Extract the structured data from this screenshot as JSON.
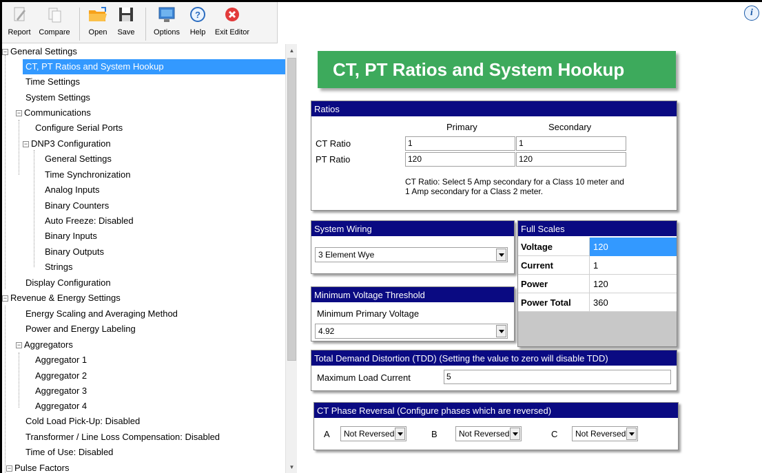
{
  "toolbar": {
    "buttons": [
      {
        "label": "Report",
        "icon": "report-icon"
      },
      {
        "label": "Compare",
        "icon": "compare-icon"
      },
      {
        "label": "Open",
        "icon": "folder-open-icon"
      },
      {
        "label": "Save",
        "icon": "floppy-disk-icon"
      },
      {
        "label": "Options",
        "icon": "options-monitor-icon"
      },
      {
        "label": "Help",
        "icon": "help-icon"
      },
      {
        "label": "Exit Editor",
        "icon": "exit-icon"
      }
    ],
    "info_glyph": "i"
  },
  "tree": {
    "items": [
      {
        "label": "General Settings",
        "expander": "−"
      },
      {
        "label": "CT, PT Ratios and System Hookup",
        "selected": true
      },
      {
        "label": "Time Settings"
      },
      {
        "label": "System Settings"
      },
      {
        "label": "Communications",
        "expander": "−"
      },
      {
        "label": "Configure Serial Ports"
      },
      {
        "label": "DNP3 Configuration",
        "expander": "−"
      },
      {
        "label": "General Settings"
      },
      {
        "label": "Time Synchronization"
      },
      {
        "label": "Analog Inputs"
      },
      {
        "label": "Binary Counters"
      },
      {
        "label": "Auto Freeze: Disabled"
      },
      {
        "label": "Binary Inputs"
      },
      {
        "label": "Binary Outputs"
      },
      {
        "label": "Strings"
      },
      {
        "label": "Display Configuration"
      },
      {
        "label": "Revenue & Energy Settings",
        "expander": "−"
      },
      {
        "label": "Energy Scaling and Averaging Method"
      },
      {
        "label": "Power and Energy Labeling"
      },
      {
        "label": "Aggregators",
        "expander": "−"
      },
      {
        "label": "Aggregator 1"
      },
      {
        "label": "Aggregator 2"
      },
      {
        "label": "Aggregator 3"
      },
      {
        "label": "Aggregator 4"
      },
      {
        "label": "Cold Load Pick-Up: Disabled"
      },
      {
        "label": "Transformer / Line Loss Compensation: Disabled"
      },
      {
        "label": "Time of Use: Disabled"
      },
      {
        "label": "Pulse Factors",
        "expander": "−"
      }
    ]
  },
  "page_title": "CT, PT Ratios and System Hookup",
  "ratios": {
    "header": "Ratios",
    "col_primary": "Primary",
    "col_secondary": "Secondary",
    "ct_label": "CT Ratio",
    "pt_label": "PT Ratio",
    "ct_primary": "1",
    "ct_secondary": "1",
    "pt_primary": "120",
    "pt_secondary": "120",
    "note_line1": "CT Ratio: Select 5 Amp secondary for a Class 10 meter and",
    "note_line2": "1 Amp secondary for a Class 2 meter."
  },
  "system_wiring": {
    "header": "System Wiring",
    "value": "3 Element Wye"
  },
  "full_scales": {
    "header": "Full Scales",
    "rows": [
      {
        "label": "Voltage",
        "value": "120",
        "selected": true
      },
      {
        "label": "Current",
        "value": "1"
      },
      {
        "label": "Power",
        "value": "120"
      },
      {
        "label": "Power Total",
        "value": "360"
      }
    ]
  },
  "min_voltage": {
    "header": "Minimum Voltage Threshold",
    "label": "Minimum Primary Voltage",
    "value": "4.92"
  },
  "tdd": {
    "header": "Total Demand Distortion (TDD) (Setting the value to zero will disable TDD)",
    "label": "Maximum Load Current",
    "value": "5"
  },
  "ct_phase": {
    "header": "CT Phase Reversal (Configure phases which are reversed)",
    "phases": [
      {
        "label": "A",
        "value": "Not Reversed"
      },
      {
        "label": "B",
        "value": "Not Reversed"
      },
      {
        "label": "C",
        "value": "Not Reversed"
      }
    ]
  },
  "colors": {
    "panel_header": "#0a0a82",
    "banner": "#3daa5c",
    "selection": "#3399ff"
  }
}
